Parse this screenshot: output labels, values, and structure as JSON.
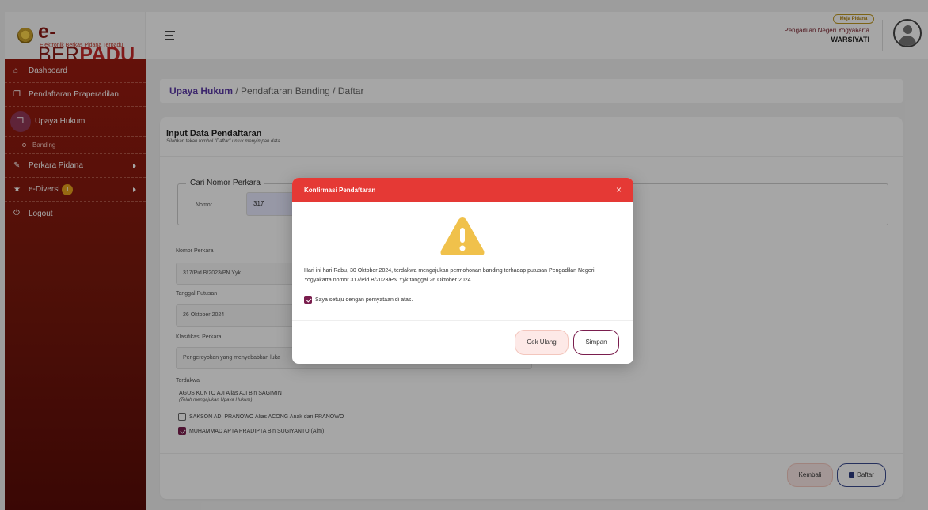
{
  "app": {
    "logo_e": "e-",
    "logo_ber": "BER",
    "logo_padu": "PADU",
    "logo_subtitle": "Elektronik Berkas Pidana Terpadu"
  },
  "header": {
    "role_badge": "Meja Pidana",
    "court_name": "Pengadilan Negeri Yogyakarta",
    "user_name": "WARSIYATI"
  },
  "sidebar": {
    "items": [
      {
        "label": "Dashboard",
        "icon": "home-icon"
      },
      {
        "label": "Pendaftaran Praperadilan",
        "icon": "copy-icon"
      },
      {
        "label": "Upaya Hukum",
        "icon": "copy-icon"
      },
      {
        "label": "Banding",
        "icon": "circle-icon"
      },
      {
        "label": "Perkara Pidana",
        "icon": "edit-icon"
      },
      {
        "label": "e-Diversi",
        "icon": "star-icon",
        "badge": "1"
      },
      {
        "label": "Logout",
        "icon": "power-icon"
      }
    ]
  },
  "breadcrumb": {
    "main": "Upaya Hukum",
    "rest": " / Pendaftaran Banding / Daftar"
  },
  "card": {
    "title": "Input Data Pendaftaran",
    "subtitle": "Silahkan tekan tombol \"Daftar\" untuk menyimpan data",
    "search_legend": "Cari Nomor Perkara",
    "search_label": "Nomor",
    "search_value": "317",
    "fields": {
      "nomor_label": "Nomor Perkara",
      "nomor_value": "317/Pid.B/2023/PN Yyk",
      "tanggal_label": "Tanggal Putusan",
      "tanggal_value": "26 Oktober 2024",
      "klasifikasi_label": "Klasifikasi Perkara",
      "klasifikasi_value": "Pengeroyokan yang menyebabkan luka"
    },
    "terdakwa_label": "Terdakwa",
    "terdakwa": [
      {
        "name": "AGUS KUNTO AJI Alias AJI Bin SAGIMIN",
        "note": "(Telah mengajukan Upaya Hukum)"
      },
      {
        "name": "SAKSON ADI PRANOWO Alias ACONG Anak dari PRANOWO",
        "checked": false
      },
      {
        "name": "MUHAMMAD APTA PRADIPTA Bin SUGIYANTO (Alm)",
        "checked": true
      }
    ],
    "btn_kembali": "Kembali",
    "btn_daftar": "Daftar"
  },
  "modal": {
    "title": "Konfirmasi Pendaftaran",
    "close": "×",
    "message": "Hari ini hari Rabu, 30 Oktober 2024, terdakwa mengajukan permohonan banding terhadap putusan Pengadilan Negeri Yogyakarta nomor 317/Pid.B/2023/PN Yyk tanggal 26 Oktober 2024.",
    "agree_label": "Saya setuju dengan pernyataan di atas.",
    "agree_checked": true,
    "btn_cek": "Cek Ulang",
    "btn_simpan": "Simpan",
    "warning_icon": "warning-icon",
    "colors": {
      "header": "#e53935",
      "warning": "#f0c14b"
    }
  }
}
